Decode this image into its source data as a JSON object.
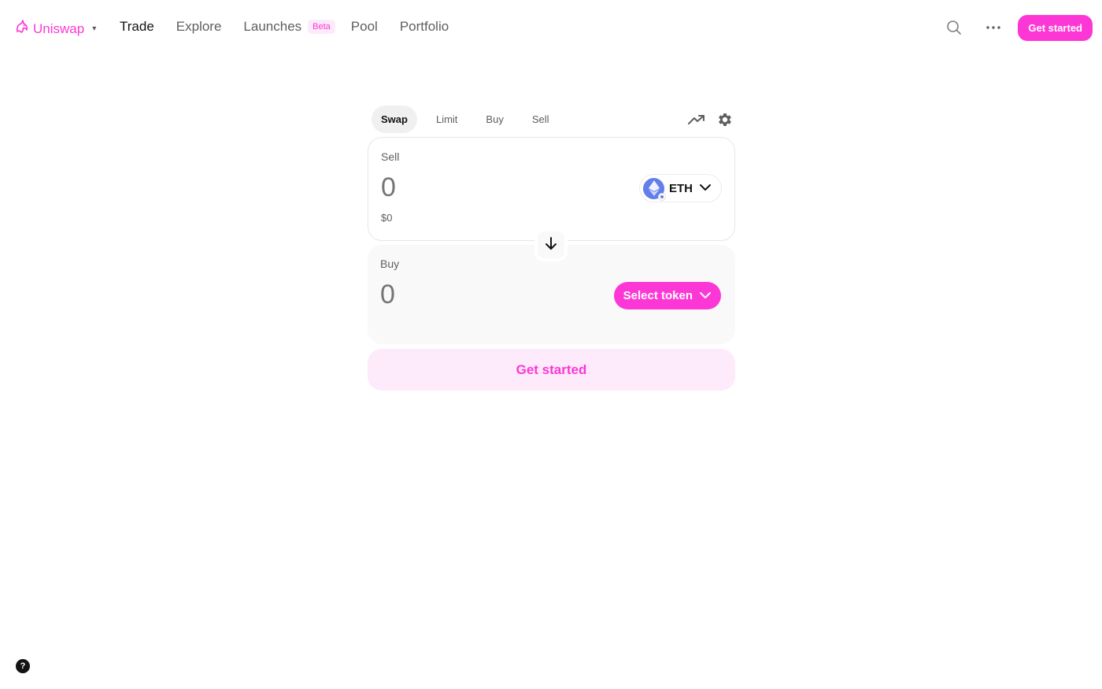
{
  "brand": {
    "name": "Uniswap",
    "accent": "#fc37d6",
    "logo_icon": "unicorn-icon",
    "caret": "▾"
  },
  "nav": {
    "links": [
      "Trade",
      "Explore",
      "Launches",
      "Pool",
      "Portfolio"
    ],
    "active": "Trade",
    "beta_badge": "Beta",
    "search_icon": "search-icon",
    "more_icon": "more-dots-icon",
    "cta_label": "Get started"
  },
  "swap": {
    "tabs": [
      "Swap",
      "Limit",
      "Buy",
      "Sell"
    ],
    "active_tab": "Swap",
    "tools": [
      "trending-chart-icon",
      "settings-gear-icon"
    ],
    "sell": {
      "label": "Sell",
      "amount_placeholder": "0",
      "usd_value": "$0",
      "token_symbol": "ETH",
      "token_icon": "eth-logo-icon"
    },
    "flip_icon": "arrow-down-icon",
    "buy": {
      "label": "Buy",
      "amount_placeholder": "0",
      "select_token_label": "Select token"
    },
    "cta_label": "Get started"
  },
  "help": {
    "label": "?",
    "icon": "help-icon"
  }
}
